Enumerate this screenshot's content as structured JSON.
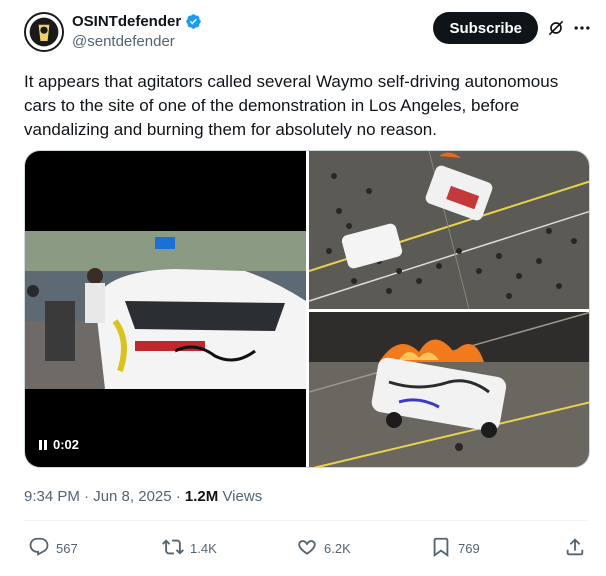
{
  "author": {
    "display_name": "OSINTdefender",
    "handle": "@sentdefender"
  },
  "header": {
    "subscribe_label": "Subscribe"
  },
  "tweet": {
    "text": "It appears that agitators called several Waymo self-driving autonomous cars to the site of one of the demonstration in Los Angeles, before vandalizing and burning them for absolutely no reason."
  },
  "media": {
    "video_time": "0:02"
  },
  "meta": {
    "timestamp": "9:34 PM · Jun 8, 2025 · ",
    "views_count": "1.2M",
    "views_label": " Views"
  },
  "actions": {
    "replies": "567",
    "reposts": "1.4K",
    "likes": "6.2K",
    "bookmarks": "769"
  },
  "colors": {
    "verified": "#1d9bf0",
    "text_primary": "#0f1419",
    "text_secondary": "#536471",
    "subscribe_bg": "#0f1419"
  },
  "icons": [
    "verified-badge-icon",
    "grok-icon",
    "more-icon",
    "pause-icon",
    "reply-icon",
    "repost-icon",
    "like-icon",
    "bookmark-icon",
    "share-icon"
  ]
}
